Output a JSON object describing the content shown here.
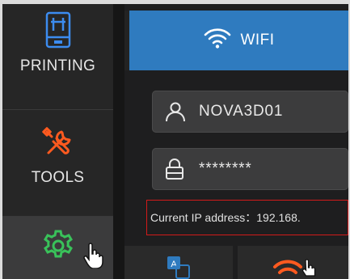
{
  "sidebar": {
    "items": [
      {
        "label": "PRINTING",
        "icon": "printer-icon"
      },
      {
        "label": "TOOLS",
        "icon": "tools-icon"
      },
      {
        "label": "",
        "icon": "gear-icon"
      }
    ]
  },
  "tabs": [
    {
      "label": "WIFI",
      "icon": "wifi-icon"
    }
  ],
  "form": {
    "ssid_value": "NOVA3D01",
    "password_value": "********",
    "ip_text": "Current IP address：192.168."
  },
  "colors": {
    "accent_blue": "#2f7bbf",
    "tools_orange": "#ff5a1f",
    "gear_green": "#39c25a",
    "highlight_red": "#d21a1a"
  }
}
